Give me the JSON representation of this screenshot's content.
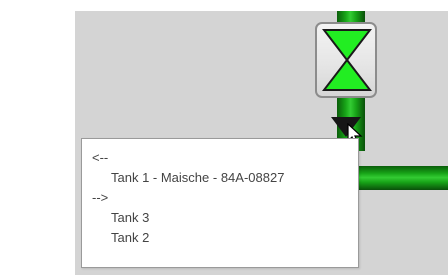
{
  "tooltip": {
    "upstream_marker": "<--",
    "upstream": [
      "Tank 1 - Maische - 84A-08827"
    ],
    "downstream_marker": "-->",
    "downstream": [
      "Tank 3",
      "Tank 2"
    ]
  },
  "icons": {
    "valve": "valve-icon",
    "flow_arrow": "flow-arrow-down-icon",
    "cursor": "mouse-pointer-icon"
  },
  "colors": {
    "pipe_green": "#17a317",
    "valve_open_green": "#22ee22",
    "canvas_gray": "#d4d4d4"
  }
}
